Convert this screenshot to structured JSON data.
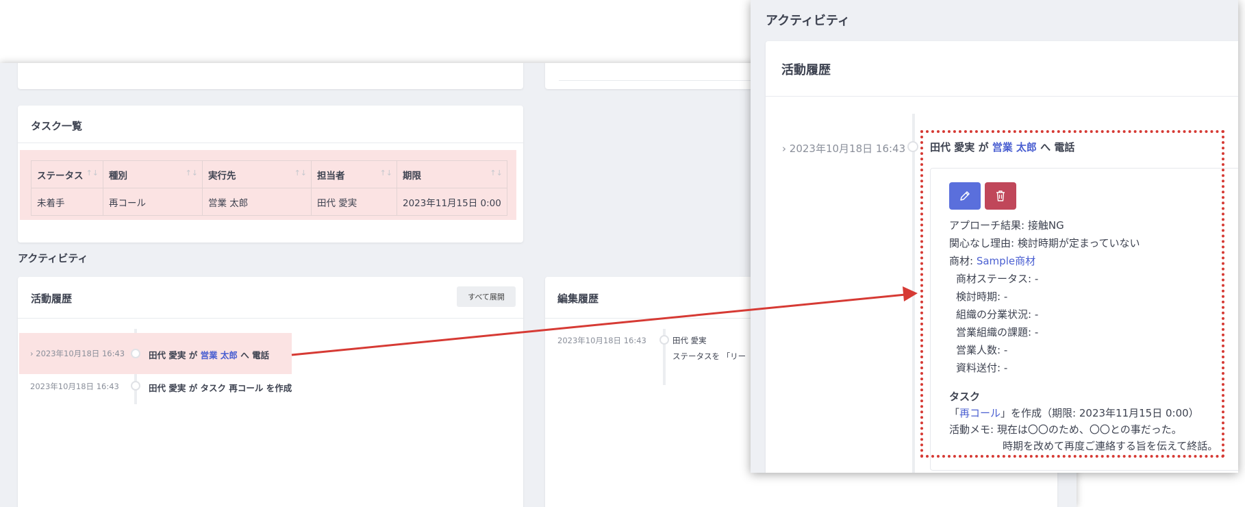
{
  "back": {
    "tasks": {
      "title": "タスク一覧",
      "columns": [
        "ステータス",
        "種別",
        "実行先",
        "担当者",
        "期限"
      ],
      "sort_icon": "↑↓",
      "row": {
        "status": "未着手",
        "type": "再コール",
        "target": "営業 太郎",
        "owner": "田代 愛実",
        "due": "2023年11月15日 0:00"
      }
    },
    "activity_heading": "アクティビティ",
    "history": {
      "title": "活動履歴",
      "expand_all": "すべて展開",
      "items": [
        {
          "chevron": "›",
          "time": "2023年10月18日 16:43",
          "actor": "田代 愛実",
          "mid": " が ",
          "target": "営業 太郎",
          "tail": " へ 電話"
        },
        {
          "time": "2023年10月18日 16:43",
          "text": "田代 愛実 が タスク 再コール を作成"
        }
      ]
    },
    "edit_history": {
      "title": "編集履歴",
      "items": [
        {
          "time": "2023年10月18日 16:43",
          "actor": "田代 愛実",
          "change": "ステータスを 「リー"
        }
      ]
    }
  },
  "front": {
    "heading": "アクティビティ",
    "card_title": "活動履歴",
    "entry": {
      "chevron": "›",
      "time": "2023年10月18日 16:43",
      "actor": "田代 愛実",
      "mid": " が ",
      "target": "営業 太郎",
      "tail": " へ 電話"
    },
    "edit_icon": "pencil-icon",
    "delete_icon": "trash-icon",
    "details": {
      "approach_label": "アプローチ結果:",
      "approach_value": "接触NG",
      "reason_label": "関心なし理由:",
      "reason_value": "検討時期が定まっていない",
      "material_label": "商材:",
      "material_value": "Sample商材",
      "sub_fields": [
        {
          "label": "商材ステータス:",
          "value": "-"
        },
        {
          "label": "検討時期:",
          "value": "-"
        },
        {
          "label": "組織の分業状況:",
          "value": "-"
        },
        {
          "label": "営業組織の課題:",
          "value": "-"
        },
        {
          "label": "営業人数:",
          "value": "-"
        },
        {
          "label": "資料送付:",
          "value": "-"
        }
      ],
      "task_heading": "タスク",
      "task_open": "「",
      "task_link": "再コール",
      "task_close": "」を作成（期限: 2023年11月15日 0:00）",
      "memo_label": "活動メモ:",
      "memo_line1": "現在は〇〇のため、〇〇との事だった。",
      "memo_line2": "時期を改めて再度ご連絡する旨を伝えて終話。"
    }
  },
  "colors": {
    "highlight": "#fbe3e3",
    "link": "#4a5fd1",
    "edit_button": "#5a6fdc",
    "delete_button": "#c0475a",
    "annotation": "#d63a34"
  }
}
